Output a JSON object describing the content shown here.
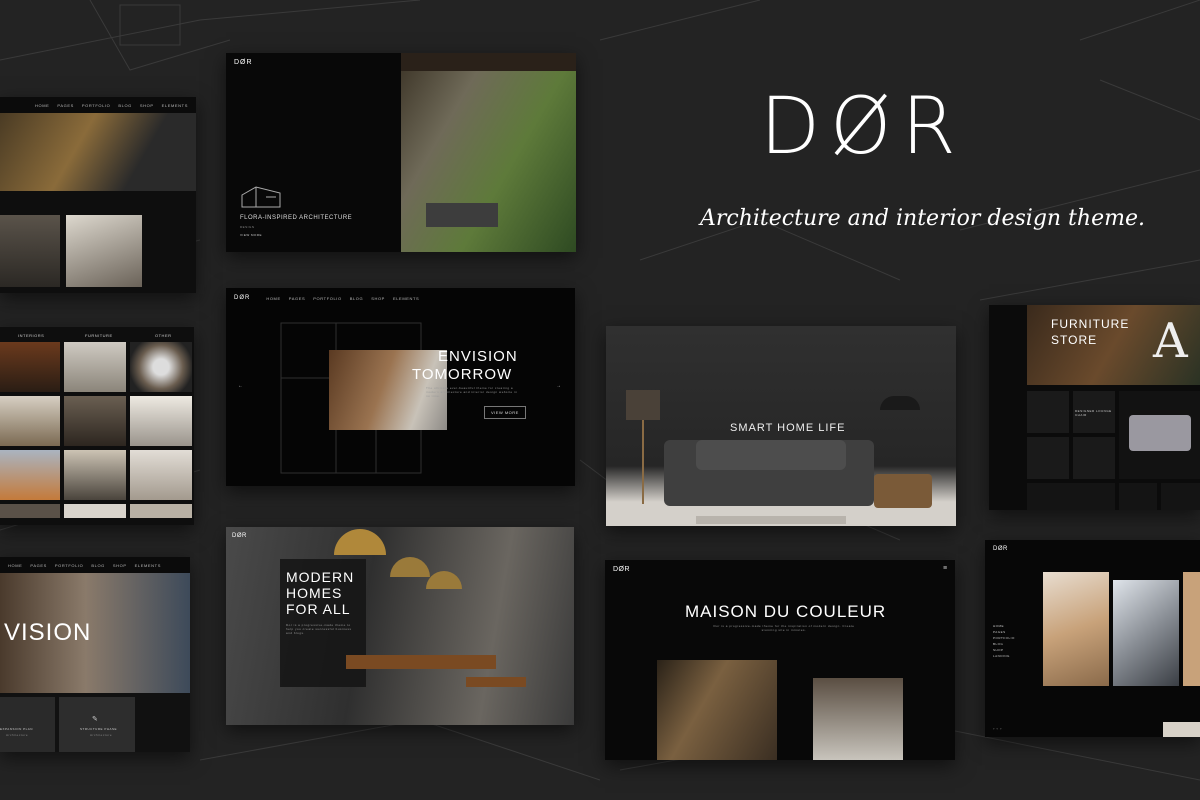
{
  "hero": {
    "brand": "DØR",
    "tagline": "Architecture and interior design theme."
  },
  "card1": {
    "nav": [
      "HOME",
      "PAGES",
      "PORTFOLIO",
      "BLOG",
      "SHOP",
      "ELEMENTS"
    ]
  },
  "card2": {
    "logo": "DØR",
    "title": "FLORA-INSPIRED ARCHITECTURE",
    "meta": "DESIGN",
    "link": "VIEW MORE"
  },
  "card3": {
    "cols": [
      "INTERIORS",
      "FURNITURE",
      "OTHER"
    ]
  },
  "card4": {
    "logo": "DØR",
    "nav": [
      "HOME",
      "PAGES",
      "PORTFOLIO",
      "BLOG",
      "SHOP",
      "ELEMENTS"
    ],
    "title_line1": "ENVISION",
    "title_line2": "TOMORROW",
    "body": "The ultimate ever-beautiful theme for creating a modern architecture and interior design website in no time.",
    "button": "VIEW MORE"
  },
  "card5": {
    "title": "SMART HOME LIFE"
  },
  "card6": {
    "title_line1": "FURNITURE",
    "title_line2": "STORE",
    "letter": "A",
    "product": "DESIGNER LOUNGE CHAIR"
  },
  "card7": {
    "nav": [
      "HOME",
      "PAGES",
      "PORTFOLIO",
      "BLOG",
      "SHOP",
      "ELEMENTS"
    ],
    "title": "VISION",
    "item1": "EXPANSION PLAN",
    "item1_sub": "Architecture",
    "item2": "STRUCTURE PHASE",
    "item2_sub": "Architecture"
  },
  "card8": {
    "logo": "DØR",
    "title_line1": "MODERN",
    "title_line2": "HOMES",
    "title_line3": "FOR ALL",
    "body": "Dor is a progressive-made theme to help you create successful business and blogs."
  },
  "card9": {
    "logo": "DØR",
    "title": "MAISON DU COULEUR",
    "body": "Dor is a progressive-made theme for the inspiration of modern design. Create stunning site in minutes."
  },
  "card10": {
    "logo": "DØR",
    "menu": [
      "HOME",
      "PAGES",
      "PORTFOLIO",
      "BLOG",
      "SHOP",
      "LANDING"
    ]
  }
}
